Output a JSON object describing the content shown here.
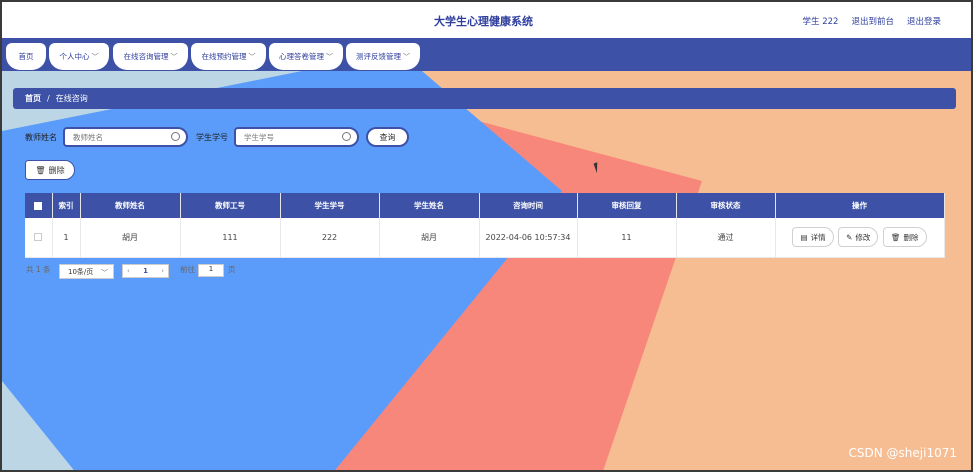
{
  "header": {
    "app_title": "大学生心理健康系统",
    "user_label": "学生 222",
    "back_to_admin": "退出到前台",
    "logout": "退出登录"
  },
  "nav": {
    "items": [
      {
        "label": "首页",
        "has_dropdown": false
      },
      {
        "label": "个人中心",
        "has_dropdown": true
      },
      {
        "label": "在线咨询管理",
        "has_dropdown": true
      },
      {
        "label": "在线预约管理",
        "has_dropdown": true
      },
      {
        "label": "心理答卷管理",
        "has_dropdown": true
      },
      {
        "label": "测评反馈管理",
        "has_dropdown": true
      }
    ]
  },
  "breadcrumb": {
    "home": "首页",
    "separator": "/",
    "current": "在线咨询"
  },
  "search": {
    "teacher_name_label": "教师姓名",
    "teacher_name_placeholder": "教师姓名",
    "student_id_label": "学生学号",
    "student_id_placeholder": "学生学号",
    "query_button": "查询"
  },
  "actions": {
    "delete_button": "删除"
  },
  "table": {
    "headers": [
      "",
      "索引",
      "教师姓名",
      "教师工号",
      "学生学号",
      "学生姓名",
      "咨询时间",
      "审核回复",
      "审核状态",
      "操作"
    ],
    "rows": [
      {
        "index": "1",
        "teacher_name": "胡月",
        "teacher_id": "111",
        "student_id": "222",
        "student_name": "胡月",
        "consult_time": "2022-04-06 10:57:34",
        "review_reply": "11",
        "review_status": "通过",
        "ops": {
          "detail": "详情",
          "edit": "修改",
          "delete": "删除"
        }
      }
    ]
  },
  "pager": {
    "total": "共 1 条",
    "page_size": "10条/页",
    "current_page": "1",
    "goto_label": "前往",
    "goto_value": "1",
    "page_unit": "页"
  },
  "watermark": "CSDN @sheji1071",
  "colors": {
    "primary": "#3d52a6",
    "bg_blue": "#5b9cfb",
    "bg_peach": "#f7bd92",
    "bg_coral": "#f7877b",
    "bg_light": "#bcd6e6"
  },
  "icons": {
    "search": "search-icon",
    "trash": "trash-icon",
    "detail": "document-icon",
    "edit": "pencil-icon",
    "chevron": "chevron-down-icon"
  }
}
